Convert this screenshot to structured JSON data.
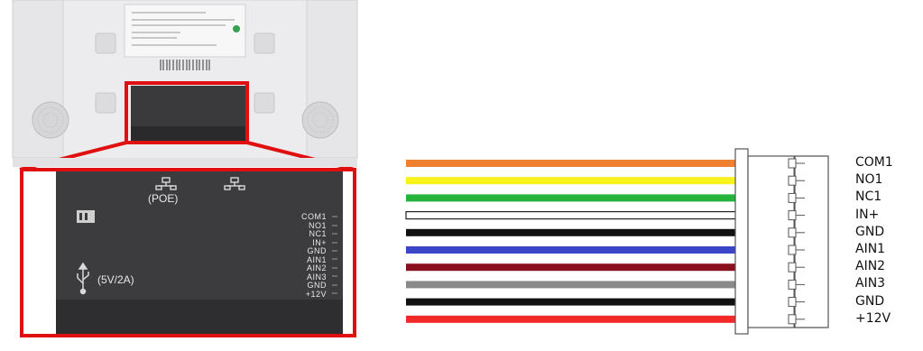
{
  "device": {
    "poe_label": "(POE)",
    "usb_label": "(5V/2A)",
    "ports": [
      "COM1",
      "NO1",
      "NC1",
      "IN+",
      "GND",
      "AIN1",
      "AIN2",
      "AIN3",
      "GND",
      "+12V"
    ]
  },
  "wiring": {
    "pins": [
      {
        "label": "COM1",
        "color": "#f08030"
      },
      {
        "label": "NO1",
        "color": "#f7f21a"
      },
      {
        "label": "NC1",
        "color": "#24b43c"
      },
      {
        "label": "IN+",
        "color": "#ffffff"
      },
      {
        "label": "GND",
        "color": "#111111"
      },
      {
        "label": "AIN1",
        "color": "#3a45c8"
      },
      {
        "label": "AIN2",
        "color": "#8a1020"
      },
      {
        "label": "AIN3",
        "color": "#8a8a8a"
      },
      {
        "label": "GND",
        "color": "#111111"
      },
      {
        "label": "+12V",
        "color": "#f02828"
      }
    ]
  }
}
